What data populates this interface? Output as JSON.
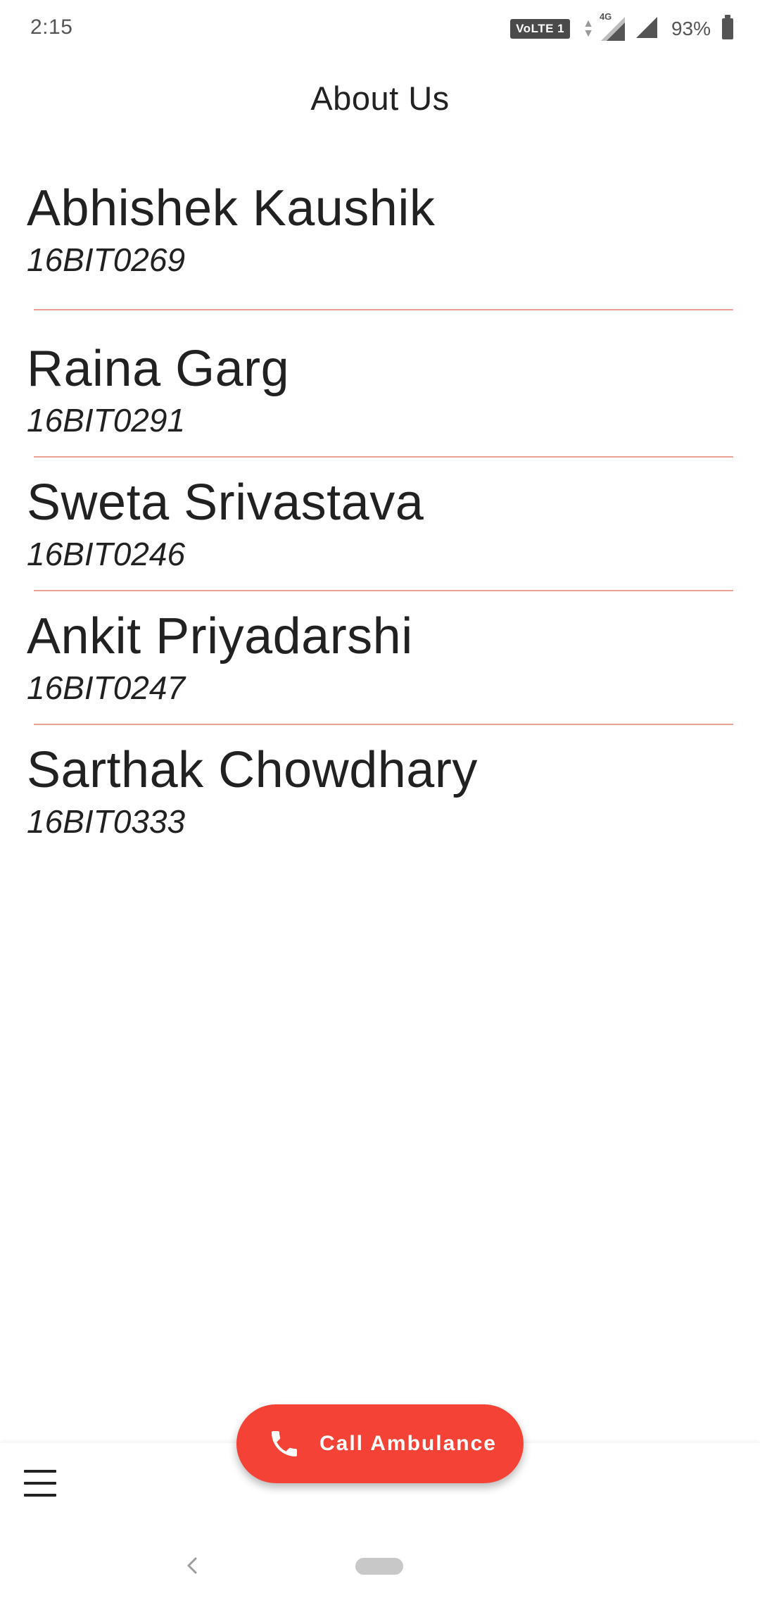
{
  "status_bar": {
    "time": "2:15",
    "volte_label": "VoLTE 1",
    "network_label": "4G",
    "battery_percent": "93%"
  },
  "header": {
    "title": "About Us"
  },
  "members": [
    {
      "name": "Abhishek Kaushik",
      "id": "16BIT0269"
    },
    {
      "name": "Raina Garg",
      "id": "16BIT0291"
    },
    {
      "name": "Sweta Srivastava",
      "id": "16BIT0246"
    },
    {
      "name": "Ankit Priyadarshi",
      "id": "16BIT0247"
    },
    {
      "name": "Sarthak Chowdhary",
      "id": "16BIT0333"
    }
  ],
  "fab": {
    "label": "Call Ambulance",
    "icon": "phone-icon",
    "color": "#f44336"
  },
  "bottom_bar": {
    "menu_icon": "hamburger-menu-icon"
  },
  "nav_bar": {
    "back_icon": "chevron-left-icon",
    "home_icon": "home-pill-icon"
  },
  "colors": {
    "divider": "#e9a097",
    "accent": "#f44336"
  }
}
